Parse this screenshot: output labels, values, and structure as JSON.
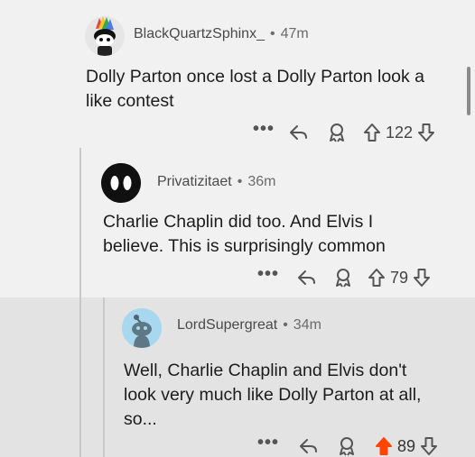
{
  "colors": {
    "upvoted": "#ff4500",
    "muted": "#6b6b6b"
  },
  "comments": [
    {
      "user": "BlackQuartzSphinx_",
      "separator": "•",
      "time": "47m",
      "body_lines": [
        "Dolly Parton once lost a Dolly Parton look a",
        "like contest"
      ],
      "more": "•••",
      "votes": "122",
      "icons": [
        "more-options-icon",
        "reply-icon",
        "award-icon",
        "upvote-icon",
        "downvote-icon"
      ]
    },
    {
      "user": "Privatizitaet",
      "separator": "•",
      "time": "36m",
      "body_lines": [
        "Charlie Chaplin did too. And Elvis I",
        "believe. This is surprisingly common"
      ],
      "more": "•••",
      "votes": "79",
      "icons": [
        "more-options-icon",
        "reply-icon",
        "award-icon",
        "upvote-icon",
        "downvote-icon"
      ]
    },
    {
      "user": "LordSupergreat",
      "separator": "•",
      "time": "34m",
      "body_lines": [
        "Well, Charlie Chaplin and Elvis don't",
        "look very much like Dolly Parton at all,",
        "so..."
      ],
      "more": "•••",
      "votes": "89",
      "upvoted": true,
      "icons": [
        "more-options-icon",
        "reply-icon",
        "award-icon",
        "upvote-icon-filled",
        "downvote-icon"
      ]
    }
  ]
}
